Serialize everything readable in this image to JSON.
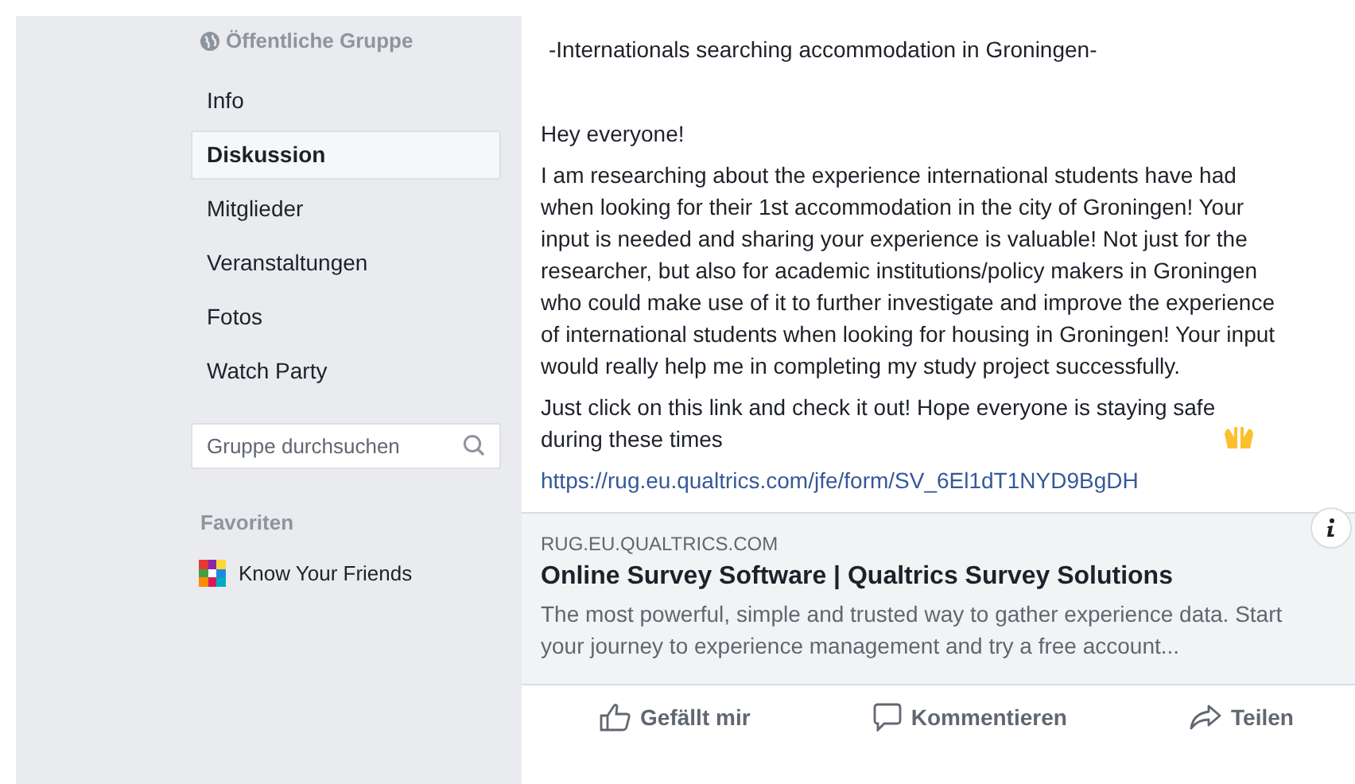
{
  "sidebar": {
    "privacy": "Öffentliche Gruppe",
    "items": [
      {
        "label": "Info",
        "selected": false
      },
      {
        "label": "Diskussion",
        "selected": true
      },
      {
        "label": "Mitglieder",
        "selected": false
      },
      {
        "label": "Veranstaltungen",
        "selected": false
      },
      {
        "label": "Fotos",
        "selected": false
      },
      {
        "label": "Watch Party",
        "selected": false
      }
    ],
    "search": {
      "placeholder": "Gruppe durchsuchen"
    },
    "favorites_heading": "Favoriten",
    "favorites": [
      {
        "label": "Know Your Friends"
      }
    ]
  },
  "post": {
    "title": "-Internationals searching accommodation in Groningen-",
    "paragraphs": [
      "Hey everyone!",
      "I am researching about the experience international students have had when looking for their 1st accommodation in the city of Groningen! Your input is needed and sharing your experience is valuable! Not just for the researcher, but also for academic institutions/policy makers in Groningen who could make use of it to further investigate and improve the experience of international students when looking for housing in Groningen! Your input would really help me in completing my study project successfully.",
      "Just click on this link and check it out! Hope everyone is staying safe during these times"
    ],
    "link": "https://rug.eu.qualtrics.com/jfe/form/SV_6El1dT1NYD9BgDH",
    "preview": {
      "domain": "RUG.EU.QUALTRICS.COM",
      "title": "Online Survey Software | Qualtrics Survey Solutions",
      "description": "The most powerful, simple and trusted way to gather experience data. Start your journey to experience management and try a free account..."
    },
    "actions": [
      {
        "kind": "like",
        "label": "Gefällt mir"
      },
      {
        "kind": "comment",
        "label": "Kommentieren"
      },
      {
        "kind": "share",
        "label": "Teilen"
      }
    ]
  }
}
